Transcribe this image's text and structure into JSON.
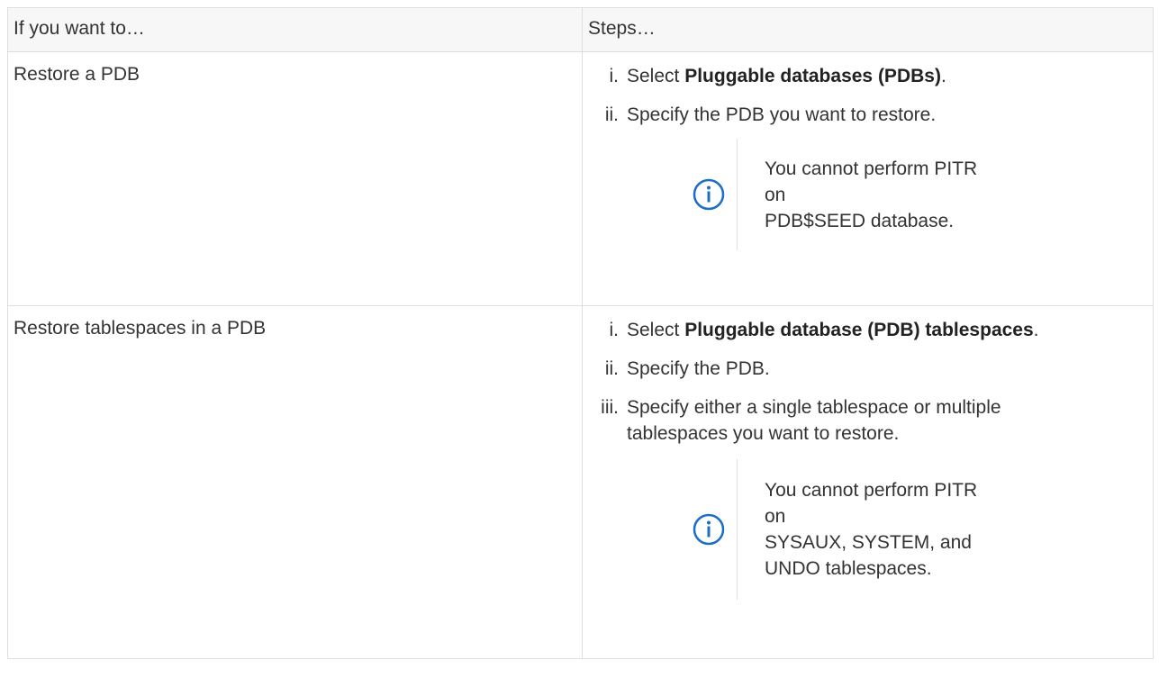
{
  "table": {
    "headers": [
      "If you want to…",
      "Steps…"
    ],
    "rows": [
      {
        "goal": "Restore a PDB",
        "steps": [
          {
            "num": "i.",
            "before": "Select ",
            "bold": "Pluggable databases (PDBs)",
            "after": "."
          },
          {
            "num": "ii.",
            "before": "Specify the PDB you want to restore.",
            "bold": "",
            "after": ""
          }
        ],
        "note": {
          "icon": "info-icon",
          "lines": [
            "You cannot perform PITR on",
            "PDB$SEED database."
          ]
        }
      },
      {
        "goal": "Restore tablespaces in a PDB",
        "steps": [
          {
            "num": "i.",
            "before": "Select ",
            "bold": "Pluggable database (PDB) tablespaces",
            "after": "."
          },
          {
            "num": "ii.",
            "before": "Specify the PDB.",
            "bold": "",
            "after": ""
          },
          {
            "num": "iii.",
            "before": "Specify either a single tablespace or multiple tablespaces you want to restore.",
            "bold": "",
            "after": ""
          }
        ],
        "note": {
          "icon": "info-icon",
          "lines": [
            "You cannot perform PITR on",
            "SYSAUX, SYSTEM, and",
            "UNDO tablespaces."
          ]
        }
      }
    ]
  },
  "colors": {
    "icon": "#1a6ec9",
    "border": "#dedede",
    "header_bg": "#f7f7f8"
  }
}
